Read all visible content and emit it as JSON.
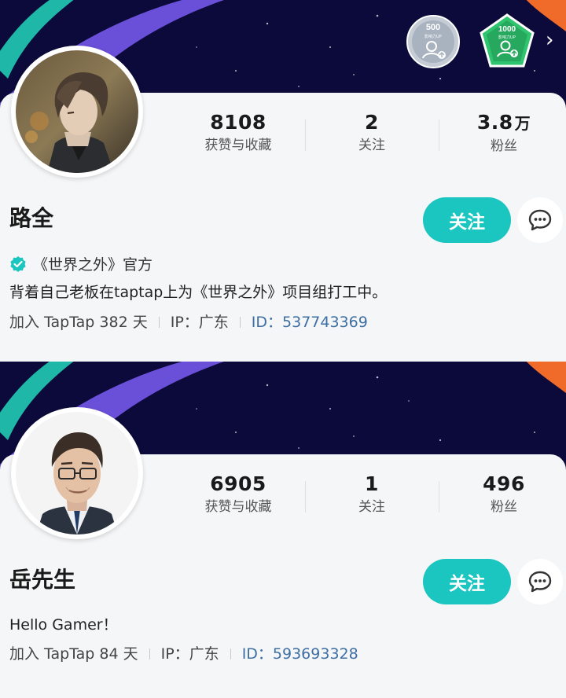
{
  "profiles": [
    {
      "name": "路全",
      "stats": [
        {
          "value": "8108",
          "unit": "",
          "label": "获赞与收藏"
        },
        {
          "value": "2",
          "unit": "",
          "label": "关注"
        },
        {
          "value": "3.8",
          "unit": "万",
          "label": "粉丝"
        }
      ],
      "follow_label": "关注",
      "verified_text": "《世界之外》官方",
      "bio": "背着自己老板在taptap上为《世界之外》项目组打工中。",
      "joined": "加入 TapTap 382 天",
      "ip": "IP：广东",
      "id_label": "ID：",
      "id_value": "537743369",
      "badges": [
        {
          "number": "500",
          "caption": "影响力UP",
          "color": "#b8c0cc"
        },
        {
          "number": "1000",
          "caption": "影响力UP",
          "color": "#2fc46e"
        }
      ]
    },
    {
      "name": "岳先生",
      "stats": [
        {
          "value": "6905",
          "unit": "",
          "label": "获赞与收藏"
        },
        {
          "value": "1",
          "unit": "",
          "label": "关注"
        },
        {
          "value": "496",
          "unit": "",
          "label": "粉丝"
        }
      ],
      "follow_label": "关注",
      "bio": "Hello Gamer！",
      "joined": "加入 TapTap 84 天",
      "ip": "IP：广东",
      "id_label": "ID：",
      "id_value": "593693328"
    }
  ],
  "chevron": "›",
  "icons": {
    "verified": "verified-check-icon",
    "message": "chat-bubble-icon",
    "more": "chevron-right-icon"
  },
  "colors": {
    "accent": "#1bc5c0",
    "banner": "#0b0a3a",
    "id_link": "#3e6fa4"
  }
}
